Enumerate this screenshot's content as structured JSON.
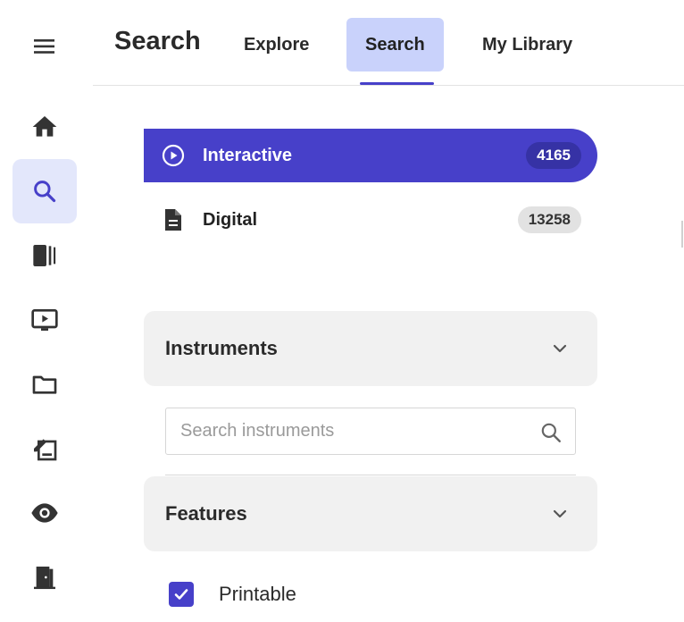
{
  "rail": {
    "items": [
      {
        "icon": "home-icon",
        "active": false
      },
      {
        "icon": "search-icon",
        "active": true
      },
      {
        "icon": "books-icon",
        "active": false
      },
      {
        "icon": "video-screen-icon",
        "active": false
      },
      {
        "icon": "folder-icon",
        "active": false
      },
      {
        "icon": "edit-document-icon",
        "active": false
      },
      {
        "icon": "eye-icon",
        "active": false
      },
      {
        "icon": "exit-door-icon",
        "active": false
      }
    ]
  },
  "header": {
    "title": "Search",
    "tabs": [
      {
        "label": "Explore",
        "active": false
      },
      {
        "label": "Search",
        "active": true
      },
      {
        "label": "My Library",
        "active": false
      }
    ]
  },
  "types": [
    {
      "label": "Interactive",
      "count": "4165",
      "icon": "play-circle-icon",
      "selected": true
    },
    {
      "label": "Digital",
      "count": "13258",
      "icon": "document-icon",
      "selected": false
    }
  ],
  "facets": {
    "instruments": {
      "title": "Instruments",
      "search_placeholder": "Search instruments",
      "search_value": ""
    },
    "features": {
      "title": "Features",
      "options": [
        {
          "label": "Printable",
          "checked": true
        }
      ]
    }
  },
  "colors": {
    "accent": "#4740c9",
    "accent_light": "#c9d2fb",
    "rail_active": "#e3e7fb",
    "facet_bg": "#f1f1f1"
  }
}
